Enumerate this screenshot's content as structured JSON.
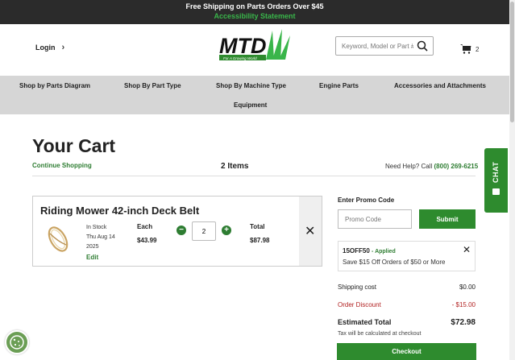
{
  "topbar": {
    "shipping_text": "Free Shipping on Parts Orders Over $45",
    "accessibility_link": "Accessibility Statement"
  },
  "header": {
    "login_label": "Login",
    "logo_text": "MTD",
    "logo_tagline": "For A Growing World",
    "search_placeholder": "Keyword, Model or Part #",
    "cart_count": "2"
  },
  "nav": {
    "items": [
      "Shop by Parts Diagram",
      "Shop By Part Type",
      "Shop By Machine Type",
      "Engine Parts",
      "Accessories and Attachments",
      "Equipment"
    ]
  },
  "cart": {
    "title": "Your Cart",
    "continue_label": "Continue Shopping",
    "items_count": "2 Items",
    "help_prefix": "Need Help? Call",
    "help_phone": "(800) 269-6215",
    "items": [
      {
        "name": "Riding Mower 42-inch Deck Belt",
        "stock": "In Stock",
        "date": "Thu Aug 14 2025",
        "edit_label": "Edit",
        "each_label": "Each",
        "each_price": "$43.99",
        "quantity": "2",
        "total_label": "Total",
        "total_price": "$87.98"
      }
    ]
  },
  "summary": {
    "promo_label": "Enter Promo Code",
    "promo_placeholder": "Promo Code",
    "submit_label": "Submit",
    "applied_code": "15OFF50",
    "applied_status": "Applied",
    "applied_desc": "Save $15 Off Orders of $50 or More",
    "shipping_label": "Shipping cost",
    "shipping_value": "$0.00",
    "discount_label": "Order Discount",
    "discount_value": "- $15.00",
    "estimated_label": "Estimated Total",
    "estimated_value": "$72.98",
    "tax_note": "Tax will be calculated at checkout",
    "checkout_label": "Checkout"
  },
  "chat": {
    "label": "CHAT"
  },
  "colors": {
    "brand_green": "#2e8b2e",
    "link_green": "#2e7d32",
    "topbar_bg": "#2b2b2b",
    "nav_bg": "#d6d6d6",
    "discount_red": "#b22222"
  },
  "icons": [
    "chevron-right-icon",
    "search-icon",
    "cart-icon",
    "close-icon",
    "minus-icon",
    "plus-icon",
    "chat-icon",
    "cookie-icon"
  ]
}
